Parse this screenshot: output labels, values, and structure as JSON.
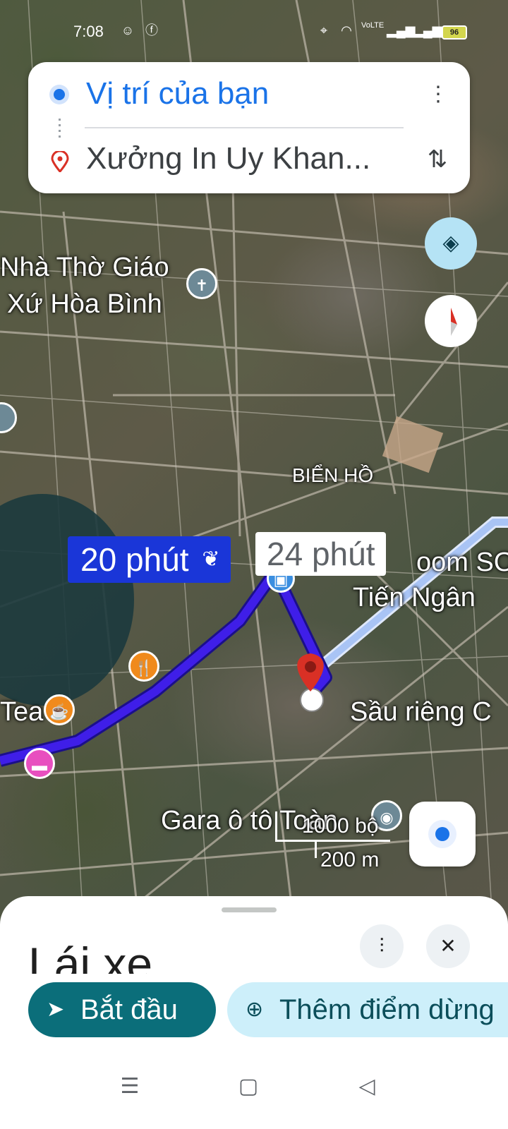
{
  "status_bar": {
    "time": "7:08",
    "battery": "96",
    "icons": [
      "smile-notification-icon",
      "facebook-icon",
      "location-icon",
      "wifi-icon",
      "volte-icon",
      "signal-icon",
      "signal-icon-2",
      "battery-icon"
    ]
  },
  "directions": {
    "origin": "Vị trí của bạn",
    "destination": "Xưởng In Uy Khan..."
  },
  "map": {
    "labels": {
      "church": "Nhà Thờ Giáo Xứ Hòa Bình",
      "church_line1": "Nhà Thờ Giáo",
      "church_line2": "Xứ Hòa Bình",
      "area": "BIỂN HỒ",
      "tea": "Tea",
      "showroom": "oom SO",
      "tien_ngan": "Tiến Ngân",
      "sau_rieng": "Sầu riêng C",
      "garage": "Gara ô tô Toàn"
    },
    "route_time_primary": "20 phút",
    "route_time_alt": "24 phút",
    "scale": {
      "feet": "1000 bộ",
      "meters": "200 m"
    },
    "accent_route": "#3f1ee8",
    "accent_alt_route": "#a9c4f5"
  },
  "sheet": {
    "title": "Lái xe",
    "start_label": "Bắt đầu",
    "add_stop_label": "Thêm điểm dừng"
  },
  "colors": {
    "start_button": "#0b6e7a",
    "add_stop_button": "#cdeffa",
    "origin_blue": "#1a73e8",
    "pin_red": "#d93025"
  }
}
